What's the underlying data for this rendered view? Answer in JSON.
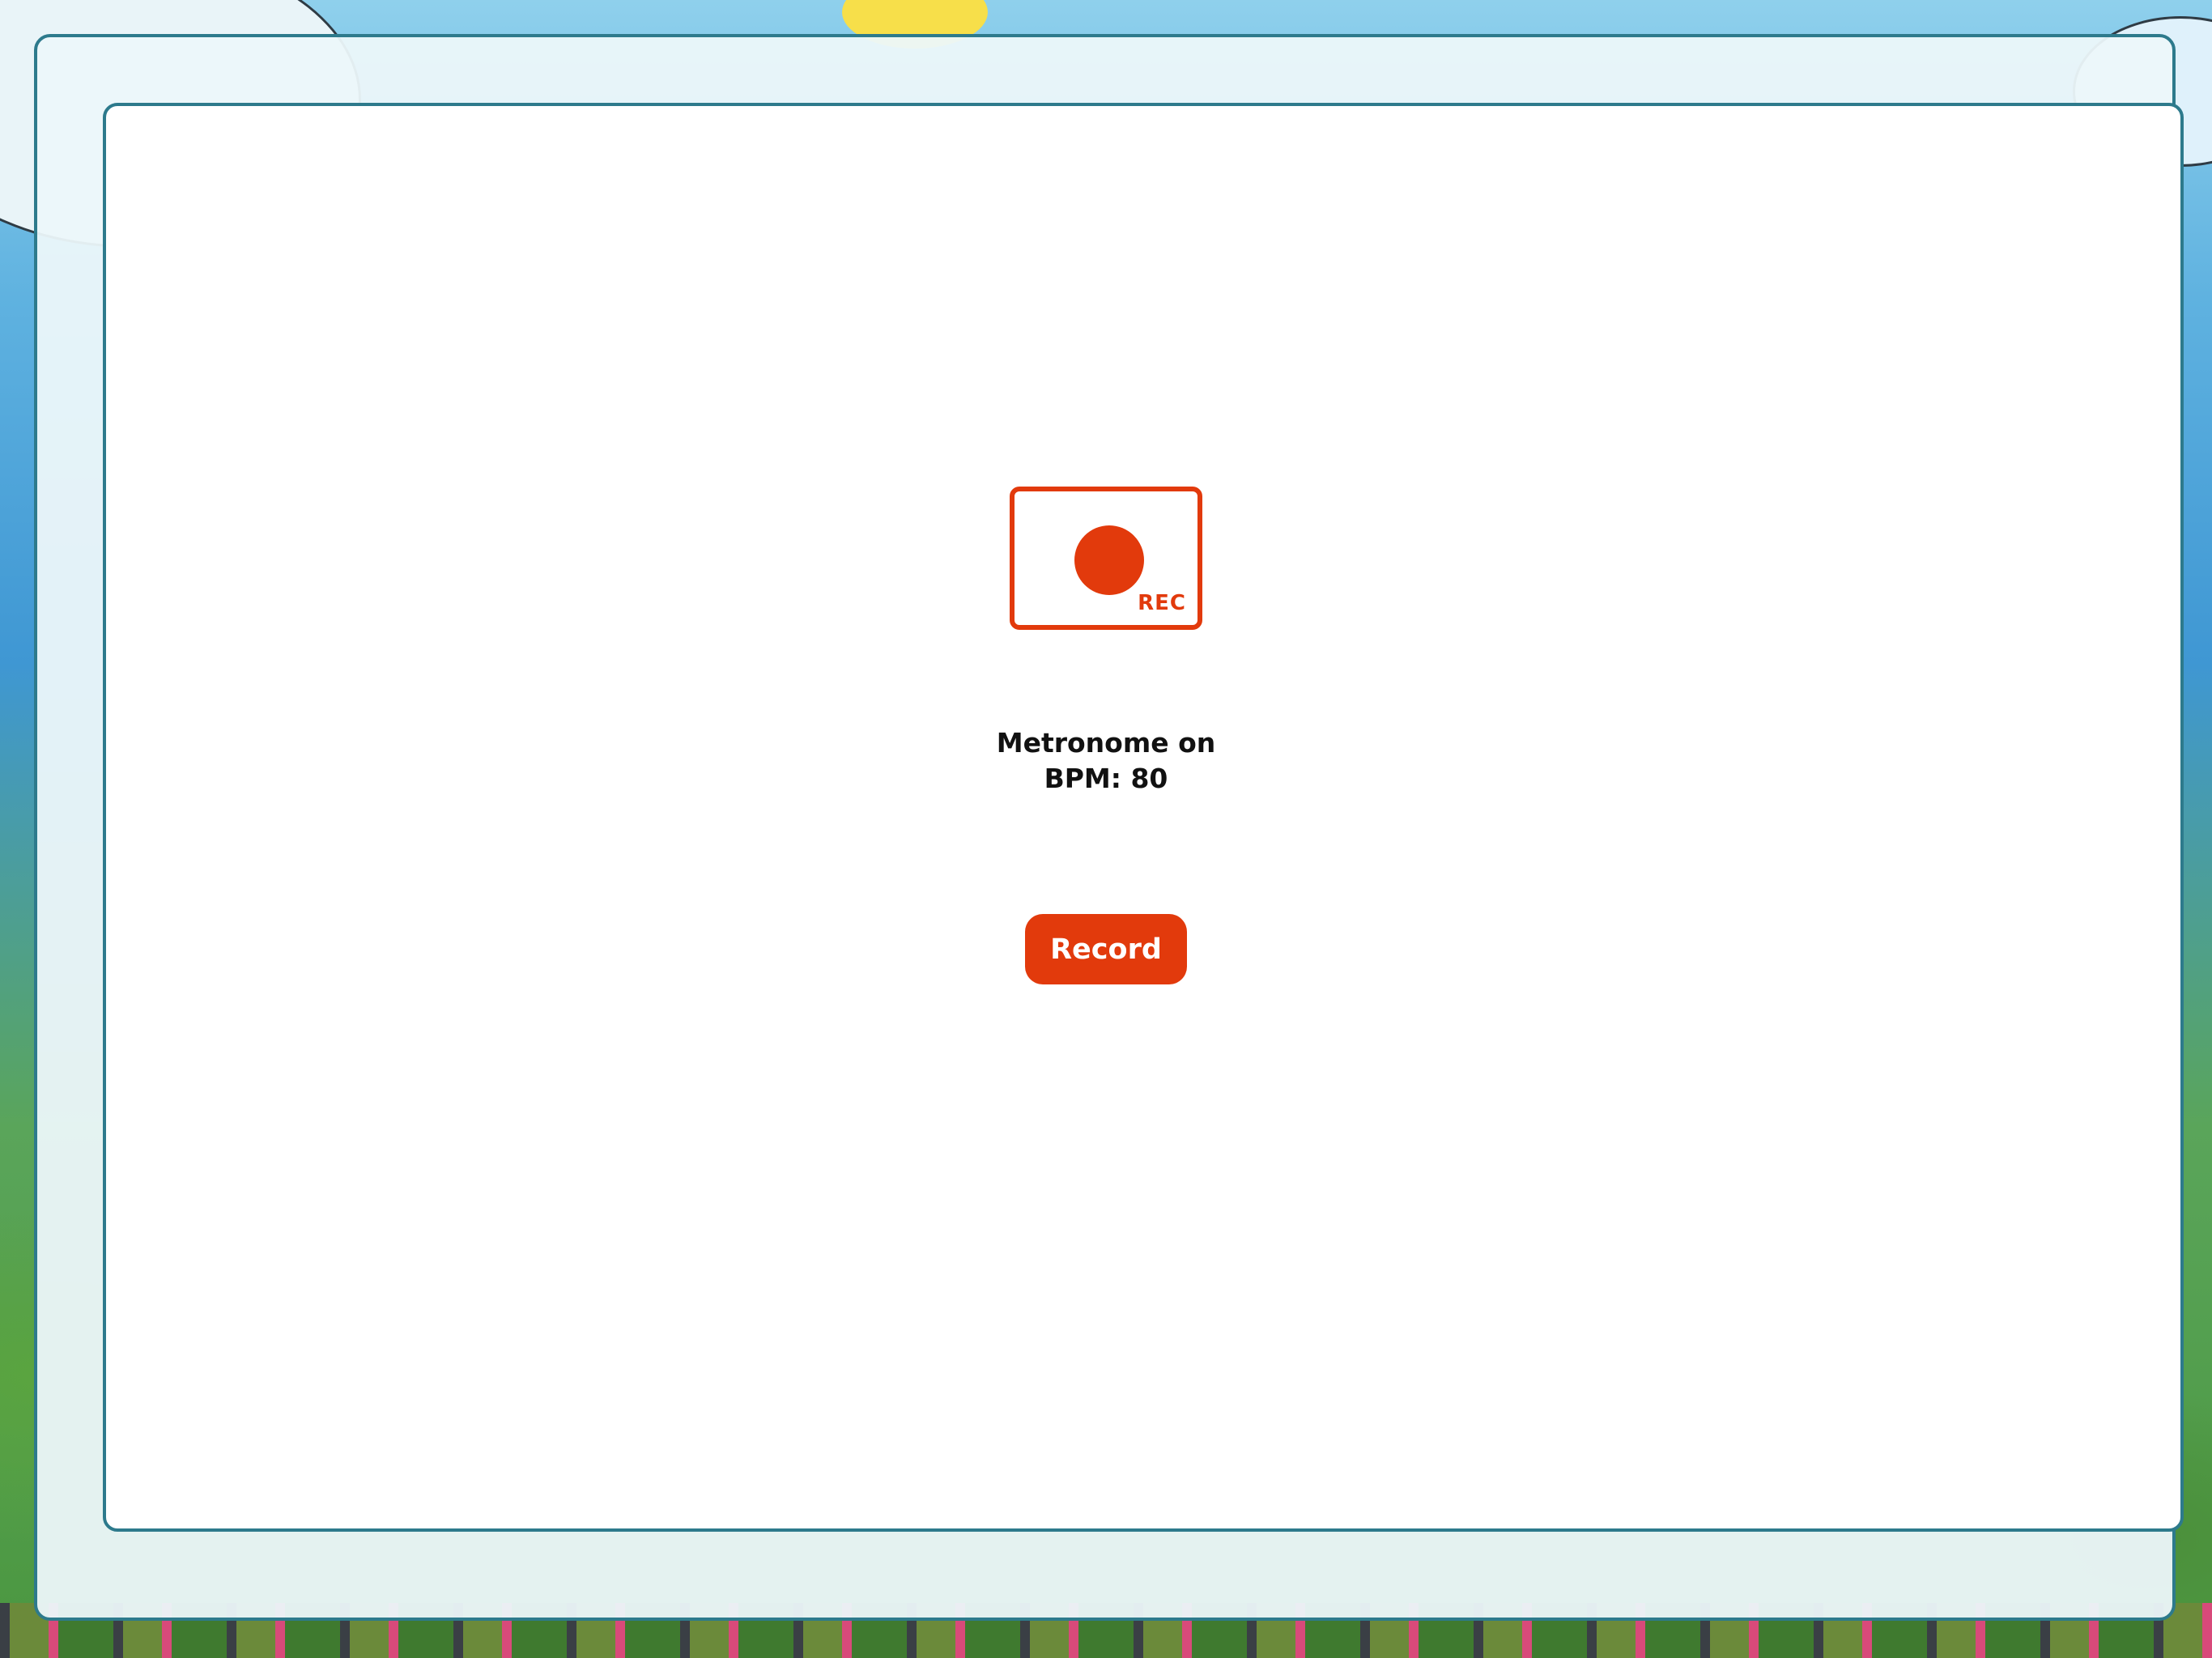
{
  "recorder": {
    "rec_label": "REC",
    "status_line1": "Metronome on",
    "status_line2": "BPM: 80",
    "record_button_label": "Record"
  },
  "colors": {
    "accent": "#e23a0c",
    "panel_border": "#2d7a8c",
    "panel_fill": "#ffffff",
    "text": "#111111"
  },
  "icons": {
    "record": "record-icon"
  }
}
